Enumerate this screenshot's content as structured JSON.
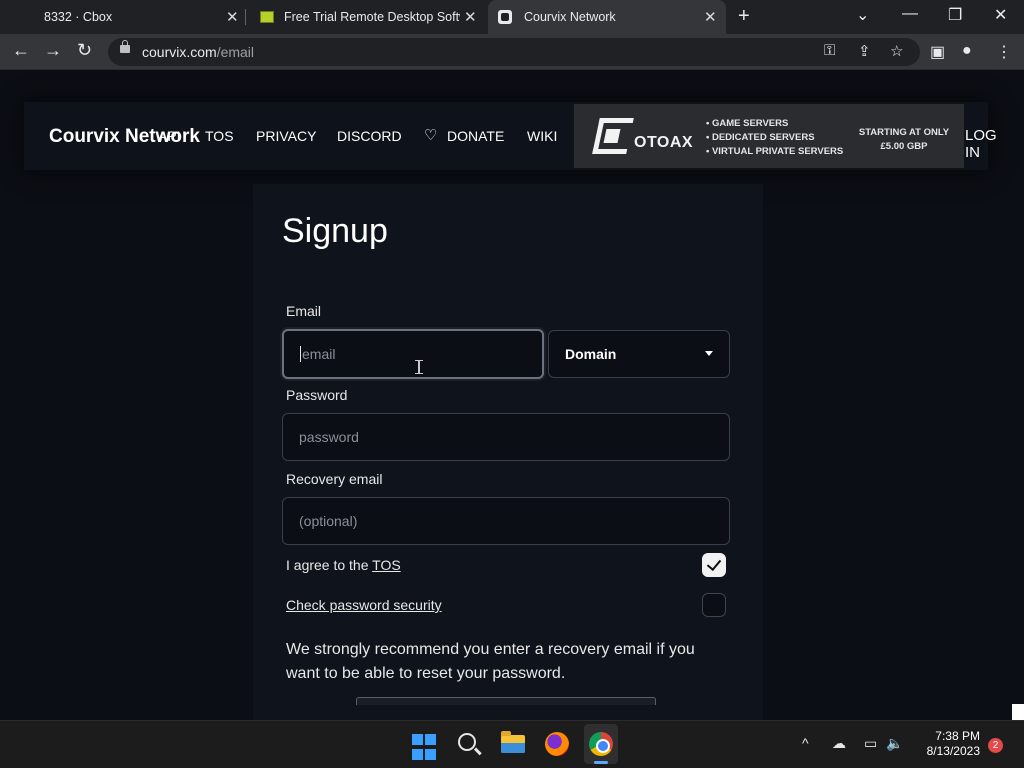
{
  "browser": {
    "tabs": [
      {
        "title": "8332 · Cbox",
        "close": "✕"
      },
      {
        "title": "Free Trial Remote Desktop Softw",
        "close": "✕"
      },
      {
        "title": "Courvix Network",
        "close": "✕"
      }
    ],
    "new_tab": "+",
    "window_controls": {
      "dropdown": "⌄",
      "minimize": "—",
      "restore": "❐",
      "close": "✕"
    },
    "nav": {
      "back": "←",
      "forward": "→",
      "reload": "↻"
    },
    "address": {
      "domain": "courvix.com",
      "path": "/email"
    },
    "omni_icons": {
      "key": "⚿",
      "share": "⇪",
      "bookmark": "☆"
    },
    "toolbar_icons": {
      "side_panel": "▣",
      "profile": "●",
      "menu": "⋮"
    }
  },
  "site": {
    "brand": "Courvix Network",
    "nav": {
      "api": "API",
      "tos": "TOS",
      "privacy": "PRIVACY",
      "discord": "DISCORD",
      "donate": "DONATE",
      "wiki": "WIKI",
      "login": "LOG IN"
    },
    "heart_icon": "♡",
    "banner": {
      "logo": "OTOAX",
      "services": [
        "• GAME SERVERS",
        "• DEDICATED SERVERS",
        "• VIRTUAL PRIVATE SERVERS"
      ],
      "price_line1": "STARTING AT ONLY",
      "price_line2": "£5.00 GBP"
    }
  },
  "form": {
    "title": "Signup",
    "email_label": "Email",
    "email_placeholder": "email",
    "domain_label": "Domain",
    "password_label": "Password",
    "password_placeholder": "password",
    "recovery_label": "Recovery email",
    "recovery_placeholder": "(optional)",
    "agree_prefix": "I agree to the ",
    "agree_link": "TOS",
    "agree_checked": true,
    "security_link": "Check password security",
    "security_checked": false,
    "note": "We strongly recommend you enter a recovery email if you want to be able to reset your password."
  },
  "taskbar": {
    "clock_time": "7:38 PM",
    "clock_date": "8/13/2023",
    "notification_count": "2",
    "tray": {
      "chevron": "^",
      "cloud": "☁",
      "network": "▭",
      "volume": "🔈"
    }
  }
}
